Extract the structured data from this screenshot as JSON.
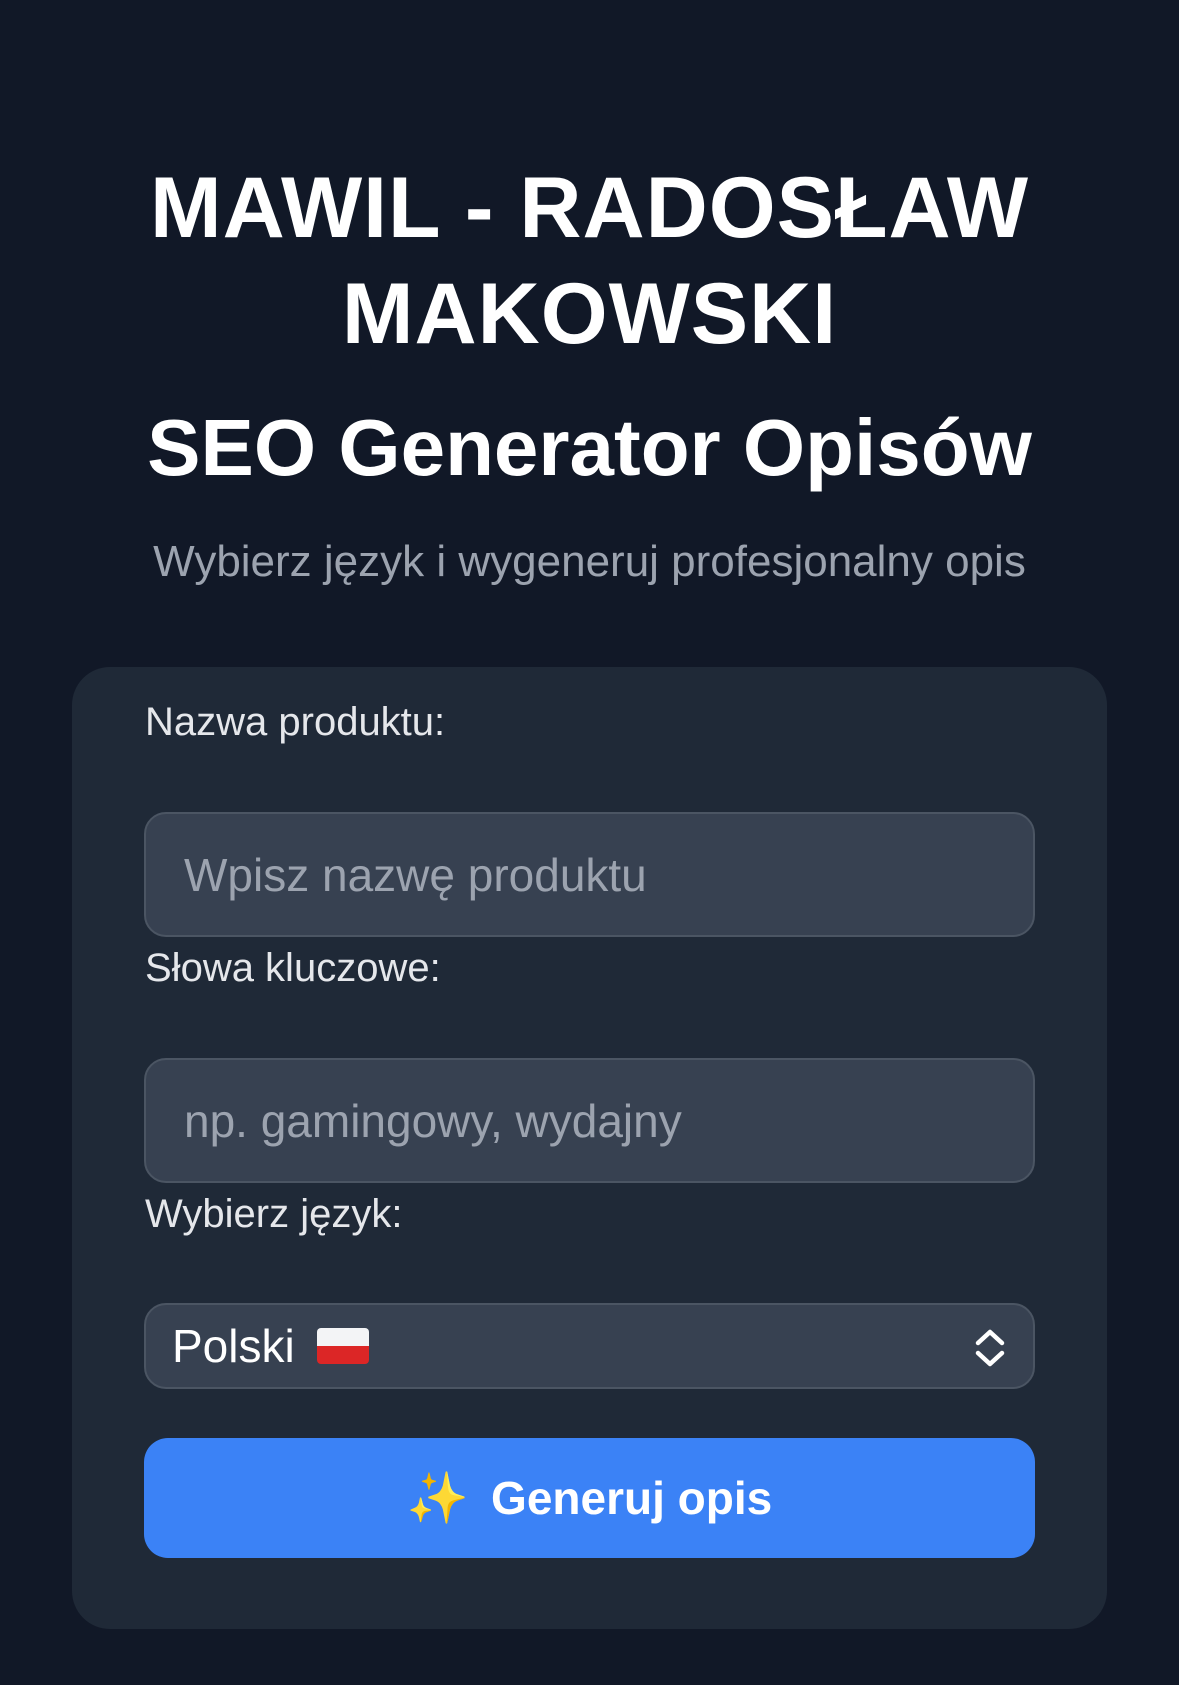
{
  "header": {
    "company": "MAWIL - RADOSŁAW MAKOWSKI",
    "title": "SEO Generator Opisów",
    "subtitle": "Wybierz język i wygeneruj profesjonalny opis"
  },
  "form": {
    "product_name": {
      "label": "Nazwa produktu:",
      "placeholder": "Wpisz nazwę produktu",
      "value": ""
    },
    "keywords": {
      "label": "Słowa kluczowe:",
      "placeholder": "np. gamingowy, wydajny",
      "value": ""
    },
    "language": {
      "label": "Wybierz język:",
      "selected": "Polski",
      "flag_icon": "poland-flag-icon"
    },
    "submit": {
      "icon": "sparkles-icon",
      "label": "Generuj opis"
    }
  },
  "colors": {
    "background": "#111827",
    "card": "#1f2937",
    "input": "#374151",
    "accent": "#3b82f6"
  }
}
